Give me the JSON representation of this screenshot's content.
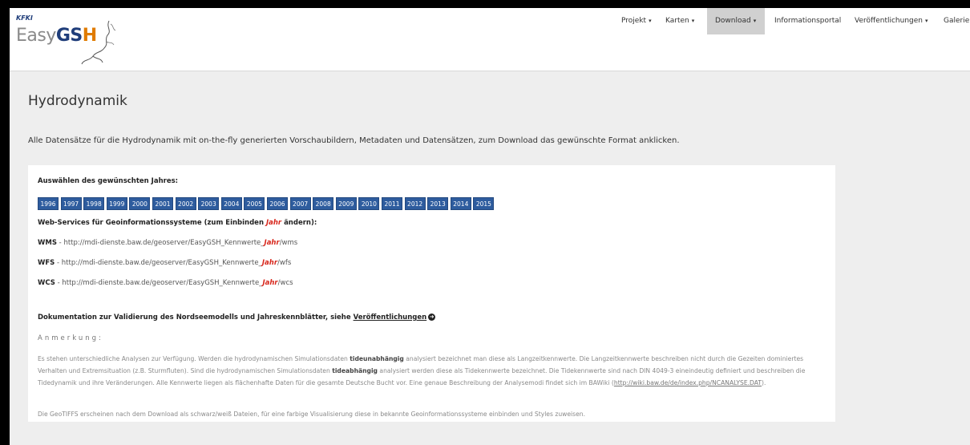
{
  "logo": {
    "fund": "KFKI",
    "easy": "Easy",
    "gs": "GS",
    "h": "H"
  },
  "nav": [
    {
      "label": "Projekt",
      "caret": "▾"
    },
    {
      "label": "Karten",
      "caret": "▾"
    },
    {
      "label": "Download",
      "caret": "▾"
    },
    {
      "label": "Informationsportal",
      "caret": ""
    },
    {
      "label": "Veröffentlichungen",
      "caret": "▾"
    },
    {
      "label": "Galerie",
      "caret": ""
    }
  ],
  "page": {
    "title": "Hydrodynamik",
    "intro": "Alle Datensätze für die Hydrodynamik mit on-the-fly generierten Vorschaubildern, Metadaten und Datensätzen, zum Download das gewünschte Format anklicken."
  },
  "panel": {
    "year_label": "Auswählen des gewünschten Jahres:",
    "years": [
      "1996",
      "1997",
      "1998",
      "1999",
      "2000",
      "2001",
      "2002",
      "2003",
      "2004",
      "2005",
      "2006",
      "2007",
      "2008",
      "2009",
      "2010",
      "2011",
      "2012",
      "2013",
      "2014",
      "2015"
    ],
    "ws_label_a": "Web-Services für Geoinformationssysteme (zum Einbinden ",
    "ws_label_jahr": "Jahr",
    "ws_label_b": " ändern):",
    "services": [
      {
        "name": "WMS",
        "url_a": " - http://mdi-dienste.baw.de/geoserver/EasyGSH_Kennwerte_",
        "jahr": "Jahr",
        "url_b": "/wms"
      },
      {
        "name": "WFS",
        "url_a": " - http://mdi-dienste.baw.de/geoserver/EasyGSH_Kennwerte_",
        "jahr": "Jahr",
        "url_b": "/wfs"
      },
      {
        "name": "WCS",
        "url_a": " - http://mdi-dienste.baw.de/geoserver/EasyGSH_Kennwerte_",
        "jahr": "Jahr",
        "url_b": "/wcs"
      }
    ],
    "doc_text": "Dokumentation zur Validierung des Nordseemodells und Jahreskennblätter, siehe ",
    "doc_link": "Veröffentlichungen",
    "anmerkung": "Anmerkung:",
    "remark": {
      "t1": "Es stehen unterschiedliche Analysen zur Verfügung. Werden die hydrodynamischen Simulationsdaten ",
      "b1": "tideunabhängig",
      "t2": " analysiert bezeichnet man diese als Langzeitkennwerte. Die Langzeitkennwerte beschreiben nicht durch die Gezeiten dominiertes Verhalten und Extremsituation (z.B. Sturmfluten). Sind die hydrodynamischen Simulationsdaten ",
      "b2": "tideabhängig",
      "t3": " analysiert werden diese als Tidekennwerte bezeichnet. Die Tidekennwerte sind nach DIN 4049-3 eineindeutig definiert und beschreiben die Tidedynamik und ihre Veränderungen. Alle Kennwerte liegen als flächenhafte Daten für die gesamte Deutsche Bucht vor. Eine genaue Beschreibung der Analysemodi findet sich im BAWiki (",
      "link": "http://wiki.baw.de/de/index.php/NCANALYSE.DAT",
      "t4": ")."
    },
    "geotiff": "Die GeoTIFFS erscheinen nach dem Download als schwarz/weiß Dateien, für eine farbige Visualisierung diese in bekannte Geoinformationssysteme einbinden und Styles zuweisen."
  }
}
